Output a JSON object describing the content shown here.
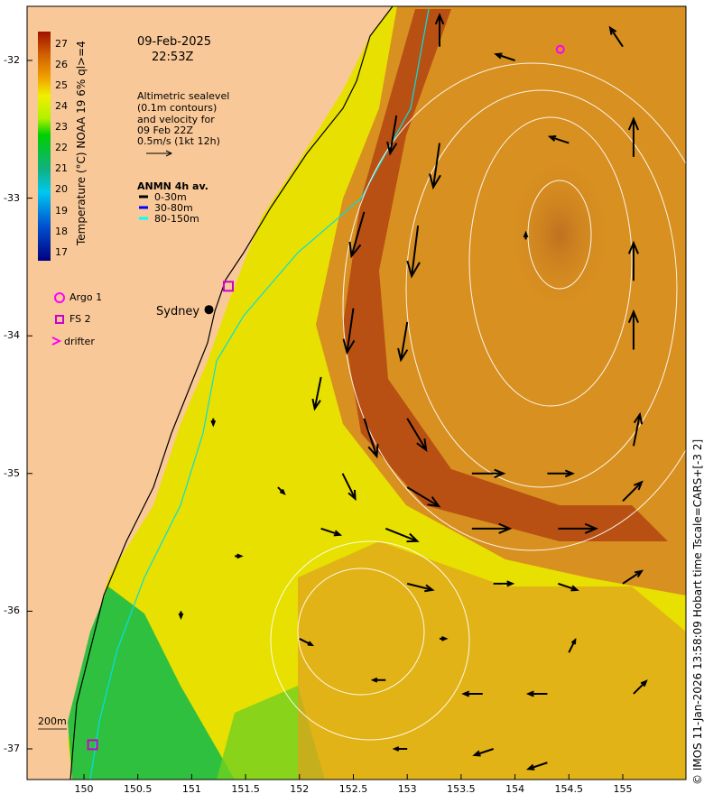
{
  "header": {
    "date": "09-Feb-2025",
    "time": "22:53Z"
  },
  "legend": {
    "altimetry_lines": [
      "Altimetric sealevel",
      "(0.1m contours)",
      "and velocity for",
      "09 Feb 22Z",
      "0.5m/s (1kt 12h)"
    ],
    "anmn_title": "ANMN 4h av.",
    "anmn_items": [
      {
        "label": "0-30m",
        "color": "#000000"
      },
      {
        "label": "30-80m",
        "color": "#0000ff"
      },
      {
        "label": "80-150m",
        "color": "#00ffff"
      }
    ],
    "markers": [
      {
        "label": "Argo 1",
        "shape": "circle",
        "color": "#ff00ff"
      },
      {
        "label": "FS 2",
        "shape": "square",
        "color": "#cc00cc"
      },
      {
        "label": "drifter",
        "shape": "chevron",
        "color": "#ff00ff"
      }
    ]
  },
  "colorbar": {
    "title": "Temperature (°C) NOAA 19 6% ql>=4",
    "ticks": [
      "27",
      "26",
      "25",
      "24",
      "23",
      "22",
      "21",
      "20",
      "19",
      "18",
      "17"
    ],
    "min": 16.6,
    "max": 27.6
  },
  "axes": {
    "x_ticks": [
      "150",
      "150.5",
      "151",
      "151.5",
      "152",
      "152.5",
      "153",
      "153.5",
      "154",
      "154.5",
      "155"
    ],
    "y_ticks": [
      "-32",
      "-33",
      "-34",
      "-35",
      "-36",
      "-37"
    ]
  },
  "places": {
    "sydney": "Sydney",
    "isobath": "200m"
  },
  "credit": "© IMOS 11-Jan-2026 13:58:09 Hobart time Tscale=CARS+[-3 2]",
  "obs": {
    "argo": {
      "lon": 154.42,
      "lat": -31.92
    },
    "fs": [
      {
        "lon": 151.34,
        "lat": -33.64
      },
      {
        "lon": 150.08,
        "lat": -36.97
      }
    ],
    "sydney": {
      "lon": 151.16,
      "lat": -33.81
    }
  },
  "vectors": [
    [
      153.3,
      -31.9,
      0.0,
      0.5
    ],
    [
      154.0,
      -32.0,
      -0.3,
      0.1
    ],
    [
      155.0,
      -31.9,
      -0.2,
      0.3
    ],
    [
      152.9,
      -32.4,
      -0.1,
      -0.6
    ],
    [
      153.3,
      -32.6,
      -0.1,
      -0.7
    ],
    [
      154.5,
      -32.6,
      -0.3,
      0.1
    ],
    [
      155.1,
      -32.7,
      0.0,
      0.6
    ],
    [
      152.6,
      -33.1,
      -0.2,
      -0.7
    ],
    [
      153.1,
      -33.2,
      -0.1,
      -0.8
    ],
    [
      154.1,
      -33.3,
      0.0,
      0.1
    ],
    [
      155.1,
      -33.6,
      0.0,
      0.6
    ],
    [
      152.5,
      -33.8,
      -0.1,
      -0.7
    ],
    [
      153.0,
      -33.9,
      -0.1,
      -0.6
    ],
    [
      155.1,
      -34.1,
      0.0,
      0.6
    ],
    [
      152.2,
      -34.3,
      -0.1,
      -0.5
    ],
    [
      152.6,
      -34.6,
      0.2,
      -0.6
    ],
    [
      153.0,
      -34.6,
      0.3,
      -0.5
    ],
    [
      155.1,
      -34.8,
      0.1,
      0.5
    ],
    [
      152.4,
      -35.0,
      0.2,
      -0.4
    ],
    [
      153.0,
      -35.1,
      0.5,
      -0.3
    ],
    [
      153.6,
      -35.0,
      0.5,
      0.0
    ],
    [
      154.3,
      -35.0,
      0.4,
      0.0
    ],
    [
      155.0,
      -35.2,
      0.3,
      0.3
    ],
    [
      152.8,
      -35.4,
      0.5,
      -0.2
    ],
    [
      153.6,
      -35.4,
      0.6,
      0.0
    ],
    [
      154.4,
      -35.4,
      0.6,
      0.0
    ],
    [
      155.0,
      -35.8,
      0.3,
      0.2
    ],
    [
      152.2,
      -35.4,
      0.3,
      -0.1
    ],
    [
      153.0,
      -35.8,
      0.4,
      -0.1
    ],
    [
      153.8,
      -35.8,
      0.3,
      0.0
    ],
    [
      154.4,
      -35.8,
      0.3,
      -0.1
    ],
    [
      152.0,
      -36.2,
      0.2,
      -0.1
    ],
    [
      153.3,
      -36.2,
      0.1,
      0.0
    ],
    [
      154.5,
      -36.3,
      0.1,
      0.2
    ],
    [
      152.8,
      -36.5,
      -0.2,
      0.0
    ],
    [
      153.7,
      -36.6,
      -0.3,
      0.0
    ],
    [
      154.3,
      -36.6,
      -0.3,
      0.0
    ],
    [
      155.1,
      -36.6,
      0.2,
      0.2
    ],
    [
      153.0,
      -37.0,
      -0.2,
      0.0
    ],
    [
      153.8,
      -37.0,
      -0.3,
      -0.1
    ],
    [
      154.3,
      -37.1,
      -0.3,
      -0.1
    ],
    [
      151.2,
      -34.6,
      0.0,
      -0.1
    ],
    [
      151.8,
      -35.1,
      0.1,
      -0.1
    ],
    [
      151.4,
      -35.6,
      0.1,
      0.0
    ],
    [
      150.9,
      -36.0,
      0.0,
      -0.1
    ]
  ]
}
